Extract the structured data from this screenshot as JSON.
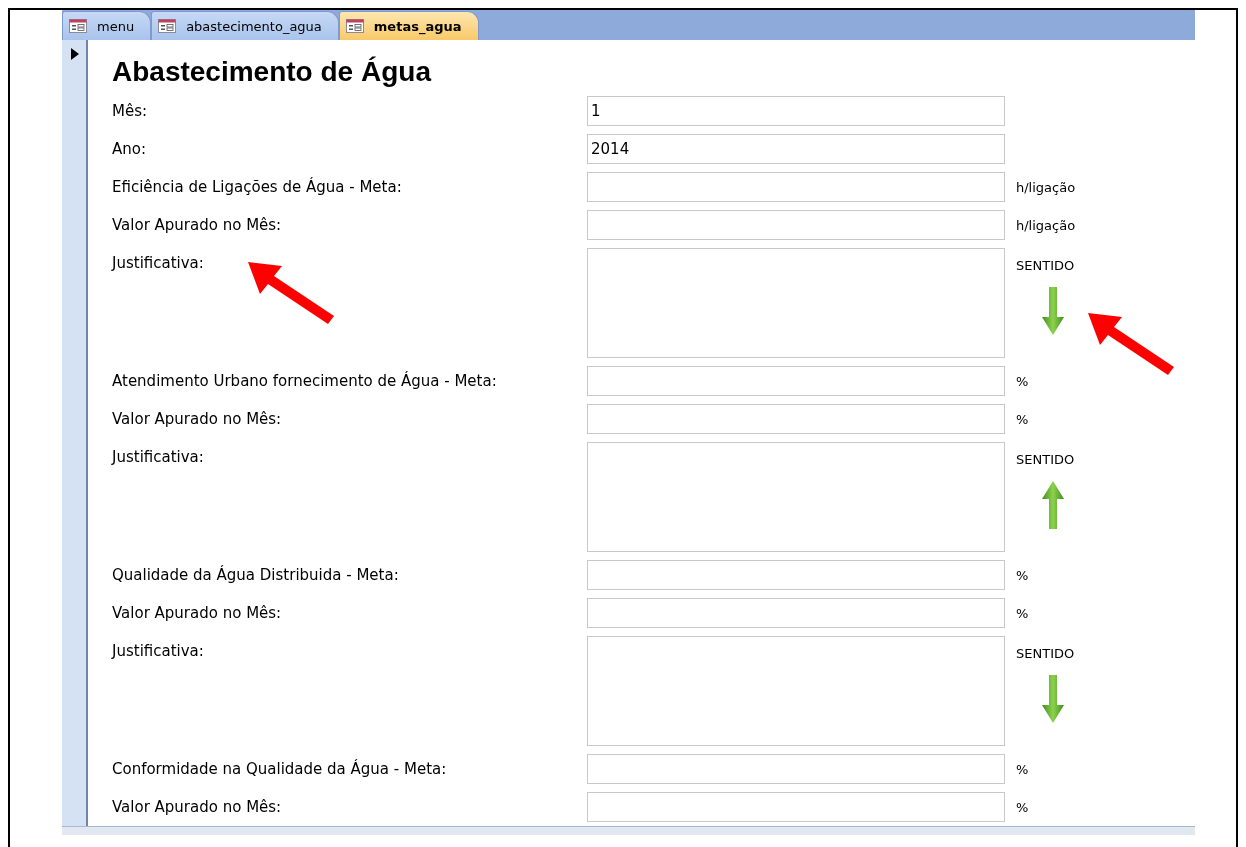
{
  "tabs": [
    {
      "label": "menu",
      "selected": false
    },
    {
      "label": "abastecimento_agua",
      "selected": false
    },
    {
      "label": "metas_agua",
      "selected": true
    }
  ],
  "form": {
    "title": "Abastecimento de Água",
    "rows": [
      {
        "kind": "field",
        "label": "Mês:",
        "value": "1"
      },
      {
        "kind": "field",
        "label": "Ano:",
        "value": "2014"
      },
      {
        "kind": "field",
        "label": "Eficiência de Ligações de Água - Meta:",
        "unit": "h/ligação"
      },
      {
        "kind": "field",
        "label": "Valor Apurado no Mês:",
        "unit": "h/ligação"
      },
      {
        "kind": "memo",
        "label": "Justificativa:",
        "caption": "SENTIDO",
        "up": false
      },
      {
        "kind": "field",
        "label": "Atendimento Urbano fornecimento de Água - Meta:",
        "unit": "%"
      },
      {
        "kind": "field",
        "label": "Valor Apurado no Mês:",
        "unit": "%"
      },
      {
        "kind": "memo",
        "label": "Justificativa:",
        "caption": "SENTIDO",
        "up": true
      },
      {
        "kind": "field",
        "label": "Qualidade da Água Distribuida - Meta:",
        "unit": "%"
      },
      {
        "kind": "field",
        "label": "Valor Apurado no Mês:",
        "unit": "%"
      },
      {
        "kind": "memo",
        "label": "Justificativa:",
        "caption": "SENTIDO",
        "up": false
      },
      {
        "kind": "field",
        "label": "Conformidade na Qualidade da Água - Meta:",
        "unit": "%"
      },
      {
        "kind": "field",
        "label": "Valor Apurado no Mês:",
        "unit": "%"
      }
    ]
  }
}
